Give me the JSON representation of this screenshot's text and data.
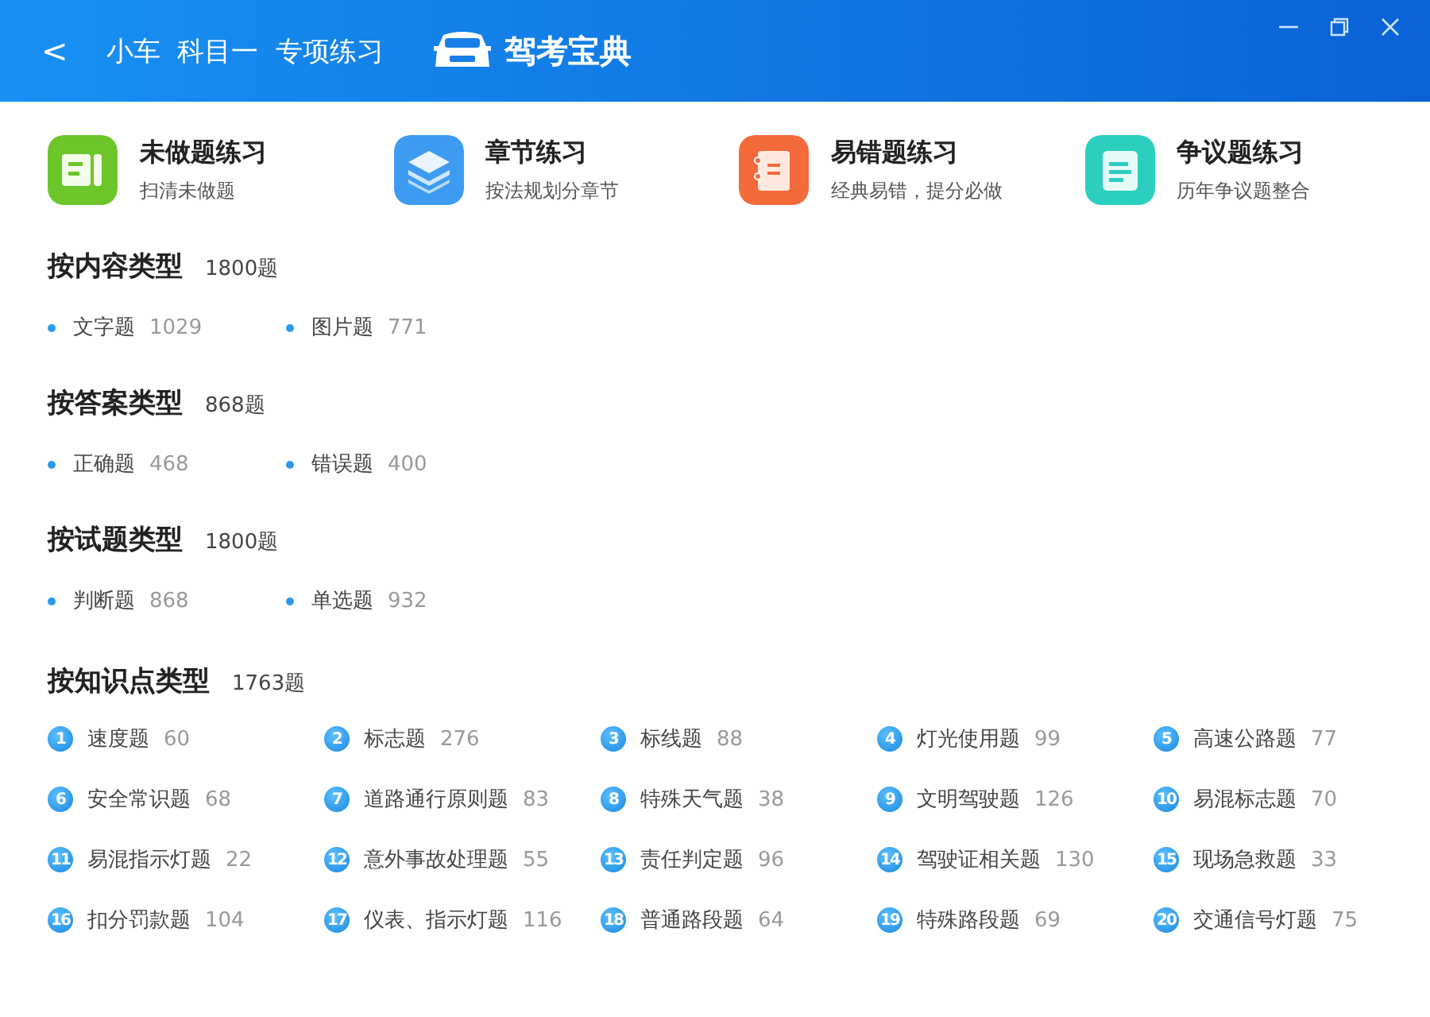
{
  "header": {
    "back": "<",
    "title": "小车  科目一  专项练习",
    "logo": "驾考宝典"
  },
  "features": [
    {
      "kind": "unanswered",
      "title": "未做题练习",
      "subtitle": "扫清未做题",
      "color": "#6cc62a"
    },
    {
      "kind": "chapter",
      "title": "章节练习",
      "subtitle": "按法规划分章节",
      "color": "#3e9bf2"
    },
    {
      "kind": "mistakes",
      "title": "易错题练习",
      "subtitle": "经典易错，提分必做",
      "color": "#f46a3a"
    },
    {
      "kind": "disputed",
      "title": "争议题练习",
      "subtitle": "历年争议题整合",
      "color": "#2ccfbf"
    }
  ],
  "sections": [
    {
      "kind": "dot",
      "title": "按内容类型",
      "count": "1800题",
      "items": [
        {
          "label": "文字题",
          "count": "1029"
        },
        {
          "label": "图片题",
          "count": "771"
        }
      ]
    },
    {
      "kind": "dot",
      "title": "按答案类型",
      "count": "868题",
      "items": [
        {
          "label": "正确题",
          "count": "468"
        },
        {
          "label": "错误题",
          "count": "400"
        }
      ]
    },
    {
      "kind": "dot",
      "title": "按试题类型",
      "count": "1800题",
      "items": [
        {
          "label": "判断题",
          "count": "868"
        },
        {
          "label": "单选题",
          "count": "932"
        }
      ]
    },
    {
      "kind": "numbered",
      "title": "按知识点类型",
      "count": "1763题",
      "items": [
        {
          "number": "1",
          "label": "速度题",
          "count": "60"
        },
        {
          "number": "2",
          "label": "标志题",
          "count": "276"
        },
        {
          "number": "3",
          "label": "标线题",
          "count": "88"
        },
        {
          "number": "4",
          "label": "灯光使用题",
          "count": "99"
        },
        {
          "number": "5",
          "label": "高速公路题",
          "count": "77"
        },
        {
          "number": "6",
          "label": "安全常识题",
          "count": "68"
        },
        {
          "number": "7",
          "label": "道路通行原则题",
          "count": "83"
        },
        {
          "number": "8",
          "label": "特殊天气题",
          "count": "38"
        },
        {
          "number": "9",
          "label": "文明驾驶题",
          "count": "126"
        },
        {
          "number": "10",
          "label": "易混标志题",
          "count": "70"
        },
        {
          "number": "11",
          "label": "易混指示灯题",
          "count": "22"
        },
        {
          "number": "12",
          "label": "意外事故处理题",
          "count": "55"
        },
        {
          "number": "13",
          "label": "责任判定题",
          "count": "96"
        },
        {
          "number": "14",
          "label": "驾驶证相关题",
          "count": "130"
        },
        {
          "number": "15",
          "label": "现场急救题",
          "count": "33"
        },
        {
          "number": "16",
          "label": "扣分罚款题",
          "count": "104"
        },
        {
          "number": "17",
          "label": "仪表、指示灯题",
          "count": "116"
        },
        {
          "number": "18",
          "label": "普通路段题",
          "count": "64"
        },
        {
          "number": "19",
          "label": "特殊路段题",
          "count": "69"
        },
        {
          "number": "20",
          "label": "交通信号灯题",
          "count": "75"
        }
      ]
    }
  ]
}
